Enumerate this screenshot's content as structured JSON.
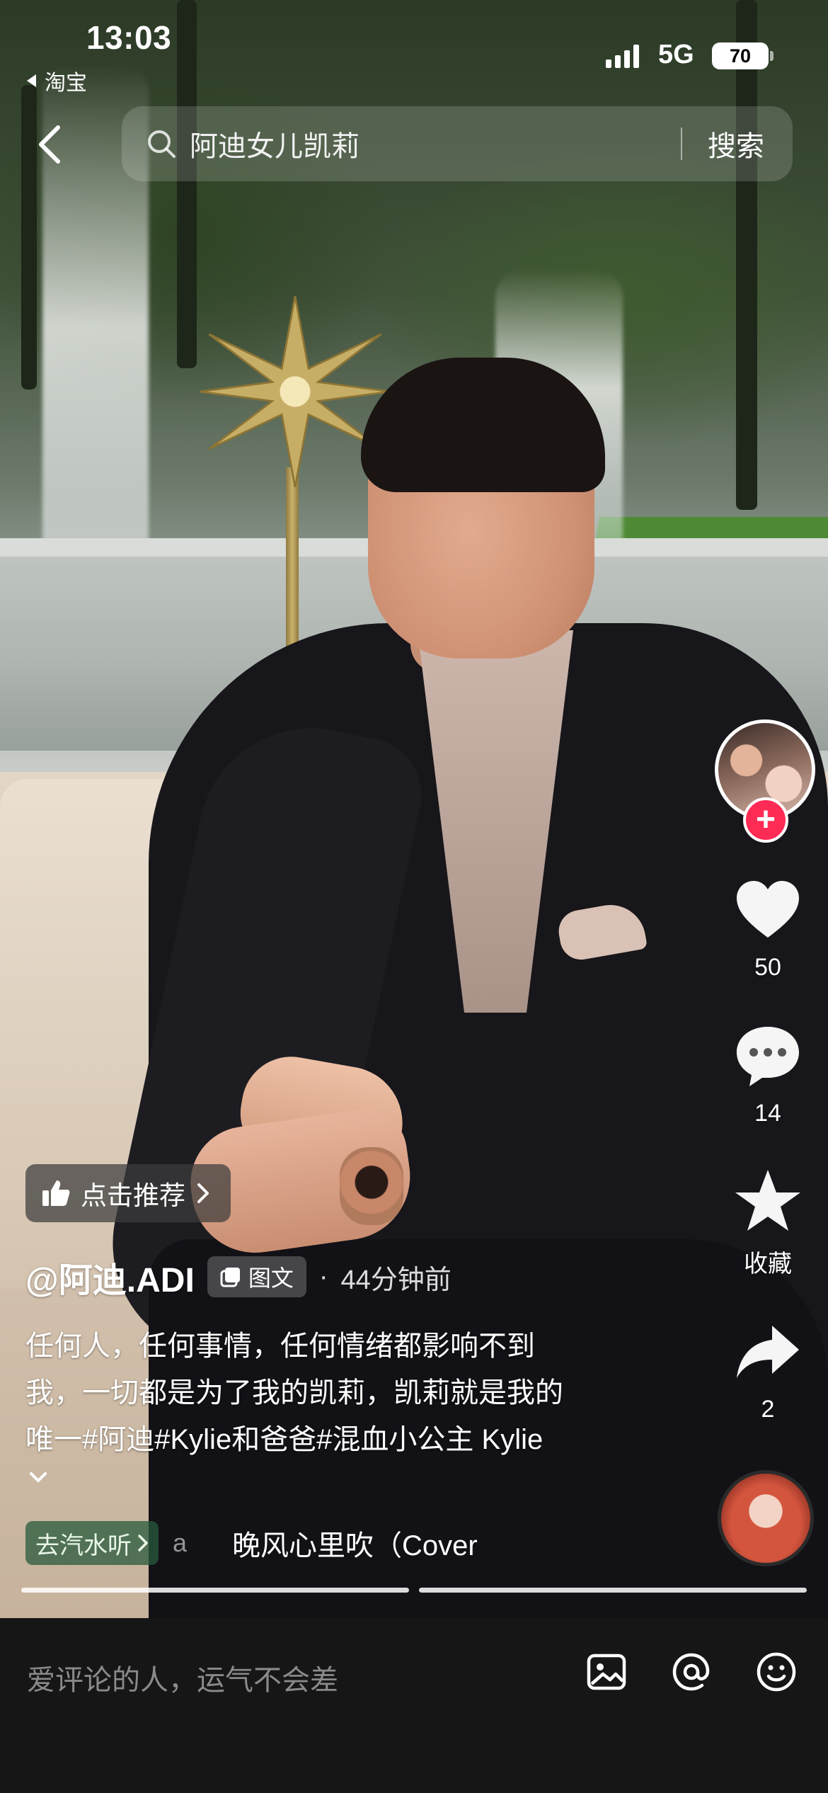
{
  "status_bar": {
    "time": "13:03",
    "back_app": "淘宝",
    "network": "5G",
    "battery": "70"
  },
  "search": {
    "query": "阿迪女儿凯莉",
    "button": "搜索"
  },
  "right_rail": {
    "likes": "50",
    "comments": "14",
    "favorite_label": "收藏",
    "shares": "2",
    "follow_symbol": "+"
  },
  "post": {
    "recommend_label": "点击推荐",
    "author": "@阿迪.ADI",
    "type_tag": "图文",
    "separator": "·",
    "time_ago": "44分钟前",
    "caption_lines": [
      "任何人，任何事情，任何情绪都影响不到",
      "我，一切都是为了我的凯莉，凯莉就是我的",
      "唯一#阿迪#Kylie和爸爸#混血小公主 Kylie"
    ]
  },
  "music": {
    "pill_label": "去汽水听",
    "fragment": "a",
    "title": "晚风心里吹（Cover"
  },
  "progress": {
    "segments": [
      {
        "state": "complete"
      },
      {
        "state": "current",
        "fraction": 1.0
      }
    ]
  },
  "comment_bar": {
    "placeholder": "爱评论的人，运气不会差",
    "icons": [
      "image-icon",
      "mention-icon",
      "emoji-icon"
    ]
  },
  "colors": {
    "follow_red": "#fe2c55",
    "bottom_bar": "#161616",
    "music_pill": "#285a3c"
  }
}
